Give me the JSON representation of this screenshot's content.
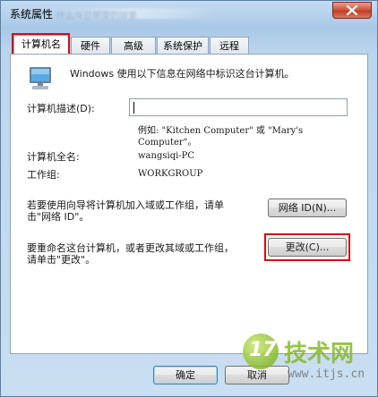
{
  "window": {
    "title": "系统属性",
    "blurred_title": "什么与日用雷的效果"
  },
  "tabs": [
    {
      "label": "计算机名",
      "active": true
    },
    {
      "label": "硬件",
      "active": false
    },
    {
      "label": "高级",
      "active": false
    },
    {
      "label": "系统保护",
      "active": false
    },
    {
      "label": "远程",
      "active": false
    }
  ],
  "panel": {
    "intro": "Windows 使用以下信息在网络中标识这台计算机。",
    "description_label": "计算机描述(D):",
    "description_value": "",
    "example_line1": "例如: \"Kitchen Computer\" 或 \"Mary's",
    "example_line2": "Computer\"。",
    "fullname_label": "计算机全名:",
    "fullname_value": "wangsiqi-PC",
    "workgroup_label": "工作组:",
    "workgroup_value": "WORKGROUP",
    "wizard_text_line1": "若要使用向导将计算机加入域或工作组，请单",
    "wizard_text_line2": "击\"网络 ID\"。",
    "network_id_button": "网络 ID(N)...",
    "rename_text_line1": "要重命名这台计算机，或者更改其域或工作组，",
    "rename_text_line2": "请单击\"更改\"。",
    "change_button": "更改(C)..."
  },
  "footer": {
    "ok_button": "确定",
    "cancel_button": "取消"
  },
  "watermark": {
    "badge": "17",
    "text": "技术网",
    "url": "www.itjs.cn"
  },
  "colors": {
    "highlight": "#d11010",
    "watermark_green": "#86b928"
  }
}
